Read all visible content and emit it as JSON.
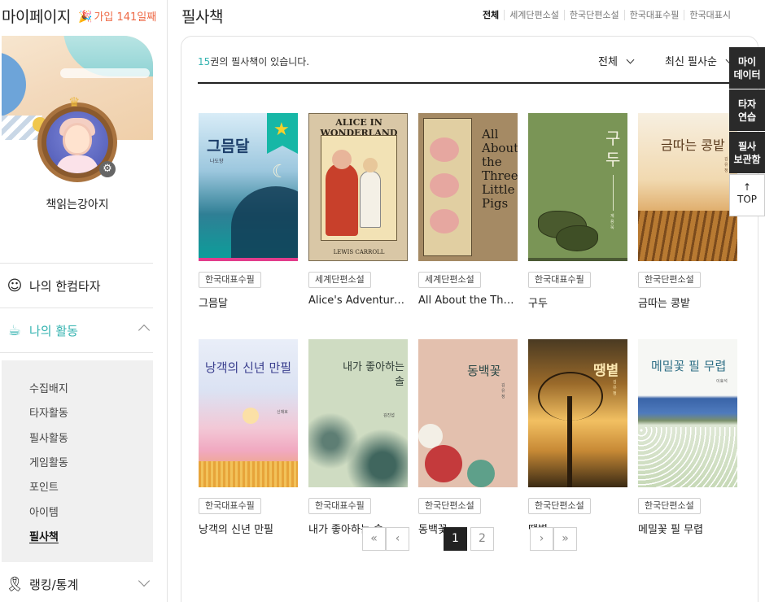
{
  "sidebar": {
    "title": "마이페이지",
    "join_badge": "가입 141일째",
    "nickname": "책읽는강아지",
    "nav": [
      {
        "label": "나의 한컴타자",
        "icon": "smile-icon"
      },
      {
        "label": "나의 활동",
        "icon": "cup-icon",
        "expanded": true
      },
      {
        "label": "랭킹/통계",
        "icon": "ribbon-icon"
      }
    ],
    "submenu": [
      "수집배지",
      "타자활동",
      "필사활동",
      "게임활동",
      "포인트",
      "아이템",
      "필사책"
    ],
    "active_submenu": "필사책"
  },
  "header": {
    "title": "필사책",
    "tabs": [
      "전체",
      "세계단편소설",
      "한국단편소설",
      "한국대표수필",
      "한국대표시"
    ],
    "active_tab": "전체"
  },
  "list": {
    "count": "15",
    "count_suffix": "권의 필사책이 있습니다.",
    "filter": "전체",
    "sort": "최신 필사순"
  },
  "books": [
    {
      "category": "한국대표수필",
      "title": "그믐달",
      "cover_title": "그믐달",
      "cover_author": "나도향",
      "starred": true
    },
    {
      "category": "세계단편소설",
      "title": "Alice's Adventures in Wonderland",
      "cover_title": "ALICE IN WONDERLAND",
      "cover_author": "LEWIS CARROLL"
    },
    {
      "category": "세계단편소설",
      "title": "All About the Three Little Pigs",
      "cover_title": "All About the Three Little Pigs"
    },
    {
      "category": "한국대표수필",
      "title": "구두",
      "cover_title": "구두",
      "cover_author": "계용묵"
    },
    {
      "category": "한국단편소설",
      "title": "금따는 콩밭",
      "cover_title": "금따는 콩밭",
      "cover_author": "김유정"
    },
    {
      "category": "한국대표수필",
      "title": "낭객의 신년 만필",
      "cover_title": "낭객의 신년 만필",
      "cover_author": "신채호"
    },
    {
      "category": "한국대표수필",
      "title": "내가 좋아하는 솔",
      "cover_title": "내가 좋아하는 솔",
      "cover_author": "김진섭"
    },
    {
      "category": "한국단편소설",
      "title": "동백꽃",
      "cover_title": "동백꽃",
      "cover_author": "김유정"
    },
    {
      "category": "한국단편소설",
      "title": "땡볕",
      "cover_title": "땡볕",
      "cover_author": "김유정"
    },
    {
      "category": "한국단편소설",
      "title": "메밀꽃 필 무렵",
      "cover_title": "메밀꽃 필 무렵",
      "cover_author": "이효석"
    }
  ],
  "pagination": {
    "pages": [
      "1",
      "2"
    ],
    "current": "1",
    "first": "«",
    "prev": "‹",
    "next": "›",
    "last": "»"
  },
  "float_panel": {
    "my_data": "마이\n데이터",
    "typing": "타자\n연습",
    "archive": "필사\n보관함",
    "top": "TOP",
    "top_arrow": "↑"
  },
  "colors": {
    "accent": "#34b3b0",
    "badge": "#ee6a46",
    "dark": "#2a2a2a"
  }
}
